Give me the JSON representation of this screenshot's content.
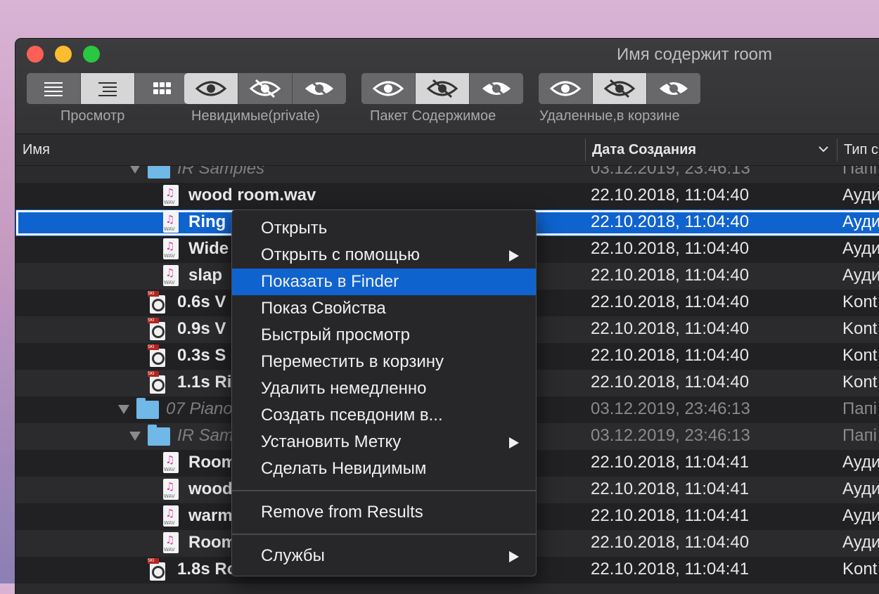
{
  "window": {
    "title": "Имя содержит room"
  },
  "toolbar": {
    "groups": [
      {
        "label": "Просмотр",
        "buttons": [
          "list-icon",
          "outline-icon",
          "grid-icon"
        ],
        "active": 1
      },
      {
        "label": "Невидимые(private)",
        "buttons": [
          "eye-icon",
          "eye-slash-icon",
          "eye-slash-filled-icon"
        ],
        "active": 0
      },
      {
        "label": "Пакет Содержимое",
        "buttons": [
          "eye-icon",
          "eye-slash-icon",
          "eye-slash-filled-icon"
        ],
        "active": 1
      },
      {
        "label": "Удаленные,в корзине",
        "buttons": [
          "eye-icon",
          "eye-slash-icon",
          "eye-slash-filled-icon"
        ],
        "active": 1
      }
    ]
  },
  "columns": {
    "name": "Имя",
    "date": "Дата Создания",
    "type": "Тип с"
  },
  "rows": [
    {
      "name": "IR Samples",
      "date": "03.12.2019, 23:46:13",
      "type": "Папі",
      "kind": "folder"
    },
    {
      "name": "wood room.wav",
      "date": "22.10.2018, 11:04:40",
      "type": "Ауди",
      "kind": "wav"
    },
    {
      "name": "Ring",
      "date": "22.10.2018, 11:04:40",
      "type": "Ауди",
      "kind": "wav",
      "selected": true
    },
    {
      "name": "Wide",
      "date": "22.10.2018, 11:04:40",
      "type": "Ауди",
      "kind": "wav"
    },
    {
      "name": "slap",
      "date": "22.10.2018, 11:04:40",
      "type": "Ауди",
      "kind": "wav"
    },
    {
      "name": "0.6s V",
      "date": "22.10.2018, 11:04:40",
      "type": "Kont",
      "kind": "ski"
    },
    {
      "name": "0.9s V",
      "date": "22.10.2018, 11:04:40",
      "type": "Kont",
      "kind": "ski"
    },
    {
      "name": "0.3s S",
      "date": "22.10.2018, 11:04:40",
      "type": "Kont",
      "kind": "ski"
    },
    {
      "name": "1.1s Ri",
      "date": "22.10.2018, 11:04:40",
      "type": "Kont",
      "kind": "ski"
    },
    {
      "name": "07 Piano",
      "date": "03.12.2019, 23:46:13",
      "type": "Папі",
      "kind": "folder"
    },
    {
      "name": "IR Sam",
      "date": "03.12.2019, 23:46:13",
      "type": "Папі",
      "kind": "folder"
    },
    {
      "name": "Room",
      "date": "22.10.2018, 11:04:41",
      "type": "Ауди",
      "kind": "wav"
    },
    {
      "name": "wood",
      "date": "22.10.2018, 11:04:41",
      "type": "Ауди",
      "kind": "wav"
    },
    {
      "name": "warm",
      "date": "22.10.2018, 11:04:41",
      "type": "Ауди",
      "kind": "wav"
    },
    {
      "name": "Room",
      "date": "22.10.2018, 11:04:40",
      "type": "Ауди",
      "kind": "wav"
    },
    {
      "name": "1.8s Ro",
      "date": "22.10.2018, 11:04:41",
      "type": "Kont",
      "kind": "ski"
    }
  ],
  "context_menu": {
    "items": [
      {
        "label": "Открыть"
      },
      {
        "label": "Открыть с помощью",
        "submenu": true
      },
      {
        "label": "Показать в Finder",
        "highlighted": true
      },
      {
        "label": "Показ Свойства"
      },
      {
        "label": "Быстрый просмотр"
      },
      {
        "label": "Переместить в корзину"
      },
      {
        "label": "Удалить немедленно"
      },
      {
        "label": "Создать псевдоним в..."
      },
      {
        "label": "Установить Метку",
        "submenu": true
      },
      {
        "label": "Сделать Невидимым"
      }
    ],
    "items2": [
      {
        "label": "Remove from Results"
      }
    ],
    "items3": [
      {
        "label": "Службы",
        "submenu": true
      }
    ]
  }
}
